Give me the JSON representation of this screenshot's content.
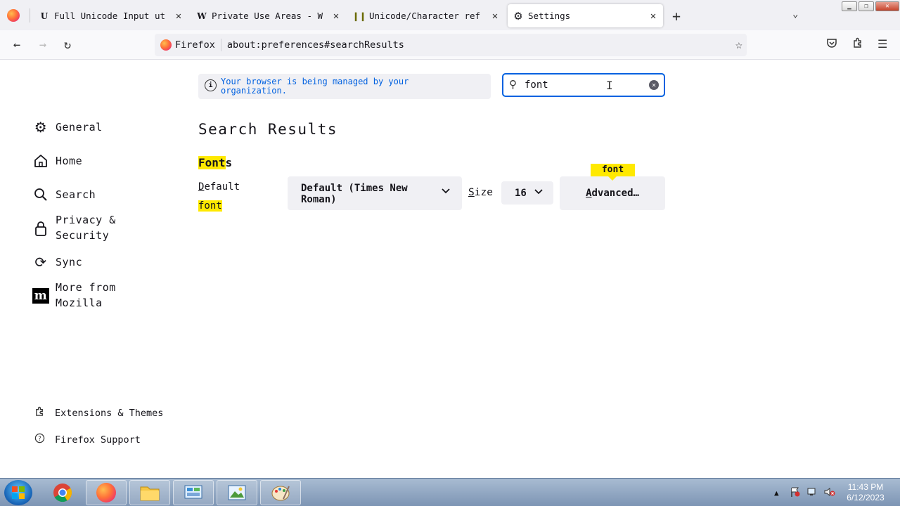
{
  "tabs": [
    {
      "title": "Full Unicode Input ut",
      "favicon": "U"
    },
    {
      "title": "Private Use Areas - W",
      "favicon": "W"
    },
    {
      "title": "Unicode/Character ref",
      "favicon": "book"
    },
    {
      "title": "Settings",
      "favicon": "gear"
    }
  ],
  "navbar": {
    "identity": "Firefox",
    "url": "about:preferences#searchResults"
  },
  "managed_notice": "Your browser is being managed by your organization.",
  "search": {
    "value": "font"
  },
  "sidebar": {
    "items": [
      {
        "label": "General"
      },
      {
        "label": "Home"
      },
      {
        "label": "Search"
      },
      {
        "label": "Privacy & Security"
      },
      {
        "label": "Sync"
      },
      {
        "label": "More from Mozilla"
      }
    ],
    "footer": [
      {
        "label": "Extensions & Themes"
      },
      {
        "label": "Firefox Support"
      }
    ]
  },
  "main": {
    "heading": "Search Results",
    "fonts_section": {
      "title_highlight": "Font",
      "title_rest": "s",
      "default_label_accesskey": "D",
      "default_label_rest": "efault",
      "default_label_highlight": "font",
      "font_dropdown": "Default (Times New Roman)",
      "size_label_accesskey": "S",
      "size_label_rest": "ize",
      "size_value": "16",
      "advanced_accesskey": "A",
      "advanced_rest": "dvanced…",
      "tooltip": "font"
    }
  },
  "taskbar": {
    "time": "11:43 PM",
    "date": "6/12/2023"
  },
  "colors": {
    "accent": "#0061e0",
    "highlight": "#ffe900"
  }
}
